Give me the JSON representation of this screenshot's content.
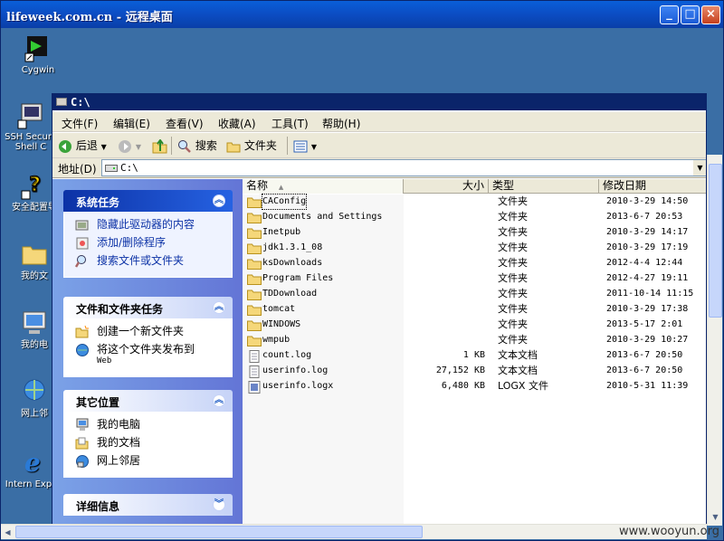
{
  "rdp": {
    "title": "lifeweek.com.cn - 远程桌面"
  },
  "desktop": {
    "icons": [
      {
        "label": "Cygwin"
      },
      {
        "label": "SSH Secure Shell C"
      },
      {
        "label": "安全配置导"
      },
      {
        "label": "我的文"
      },
      {
        "label": "我的电"
      },
      {
        "label": "网上邻"
      },
      {
        "label": "Intern Explor"
      }
    ]
  },
  "explorer": {
    "title": "C:\\",
    "menu": [
      "文件(F)",
      "编辑(E)",
      "查看(V)",
      "收藏(A)",
      "工具(T)",
      "帮助(H)"
    ],
    "toolbar": {
      "back": "后退",
      "search": "搜索",
      "folders": "文件夹"
    },
    "address": {
      "label": "地址(D)",
      "value": "C:\\"
    },
    "tasks": {
      "system": {
        "title": "系统任务",
        "items": [
          "隐藏此驱动器的内容",
          "添加/删除程序",
          "搜索文件或文件夹"
        ]
      },
      "file": {
        "title": "文件和文件夹任务",
        "items": [
          "创建一个新文件夹"
        ],
        "publish": {
          "line1": "将这个文件夹发布到",
          "line2": "Web"
        }
      },
      "other": {
        "title": "其它位置",
        "items": [
          "我的电脑",
          "我的文档",
          "网上邻居"
        ]
      },
      "details": {
        "title": "详细信息"
      }
    },
    "columns": {
      "name": "名称",
      "size": "大小",
      "type": "类型",
      "modified": "修改日期"
    },
    "files": [
      {
        "name": "CAConfig",
        "size": "",
        "type": "文件夹",
        "date": "2010-3-29 14:50",
        "kind": "folder"
      },
      {
        "name": "Documents and Settings",
        "size": "",
        "type": "文件夹",
        "date": "2013-6-7 20:53",
        "kind": "folder"
      },
      {
        "name": "Inetpub",
        "size": "",
        "type": "文件夹",
        "date": "2010-3-29 14:17",
        "kind": "folder"
      },
      {
        "name": "jdk1.3.1_08",
        "size": "",
        "type": "文件夹",
        "date": "2010-3-29 17:19",
        "kind": "folder"
      },
      {
        "name": "ksDownloads",
        "size": "",
        "type": "文件夹",
        "date": "2012-4-4 12:44",
        "kind": "folder"
      },
      {
        "name": "Program Files",
        "size": "",
        "type": "文件夹",
        "date": "2012-4-27 19:11",
        "kind": "folder"
      },
      {
        "name": "TDDownload",
        "size": "",
        "type": "文件夹",
        "date": "2011-10-14 11:15",
        "kind": "folder"
      },
      {
        "name": "tomcat",
        "size": "",
        "type": "文件夹",
        "date": "2010-3-29 17:38",
        "kind": "folder"
      },
      {
        "name": "WINDOWS",
        "size": "",
        "type": "文件夹",
        "date": "2013-5-17 2:01",
        "kind": "folder"
      },
      {
        "name": "wmpub",
        "size": "",
        "type": "文件夹",
        "date": "2010-3-29 10:27",
        "kind": "folder"
      },
      {
        "name": "count.log",
        "size": "1 KB",
        "type": "文本文档",
        "date": "2013-6-7 20:50",
        "kind": "text"
      },
      {
        "name": "userinfo.log",
        "size": "27,152 KB",
        "type": "文本文档",
        "date": "2013-6-7 20:50",
        "kind": "text"
      },
      {
        "name": "userinfo.logx",
        "size": "6,480 KB",
        "type": "LOGX 文件",
        "date": "2010-5-31 11:39",
        "kind": "logx"
      }
    ]
  },
  "watermark": "www.wooyun.org"
}
